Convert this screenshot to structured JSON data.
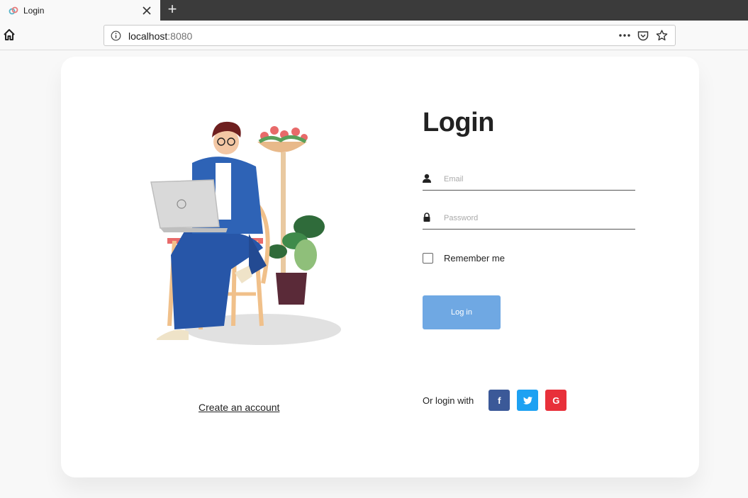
{
  "browser": {
    "tab_title": "Login",
    "new_tab_symbol": "+",
    "url_host": "localhost",
    "url_port": ":8080"
  },
  "icons": {
    "home": "home-icon",
    "info": "info-icon",
    "more": "more-icon",
    "pocket": "pocket-icon",
    "star": "bookmark-star-icon",
    "user": "user-icon",
    "lock": "lock-icon",
    "facebook": "facebook-icon",
    "twitter": "twitter-icon",
    "google": "google-icon"
  },
  "login": {
    "title": "Login",
    "email_placeholder": "Email",
    "email_value": "",
    "password_placeholder": "Password",
    "password_value": "",
    "remember_label": "Remember me",
    "remember_checked": false,
    "submit_label": "Log in",
    "social_label": "Or login with",
    "facebook_glyph": "f",
    "google_glyph": "G"
  },
  "signup": {
    "create_account_label": "Create an account"
  },
  "colors": {
    "button": "#6fa8e3",
    "facebook": "#3b5998",
    "twitter": "#1da1f2",
    "google": "#e8303a"
  }
}
